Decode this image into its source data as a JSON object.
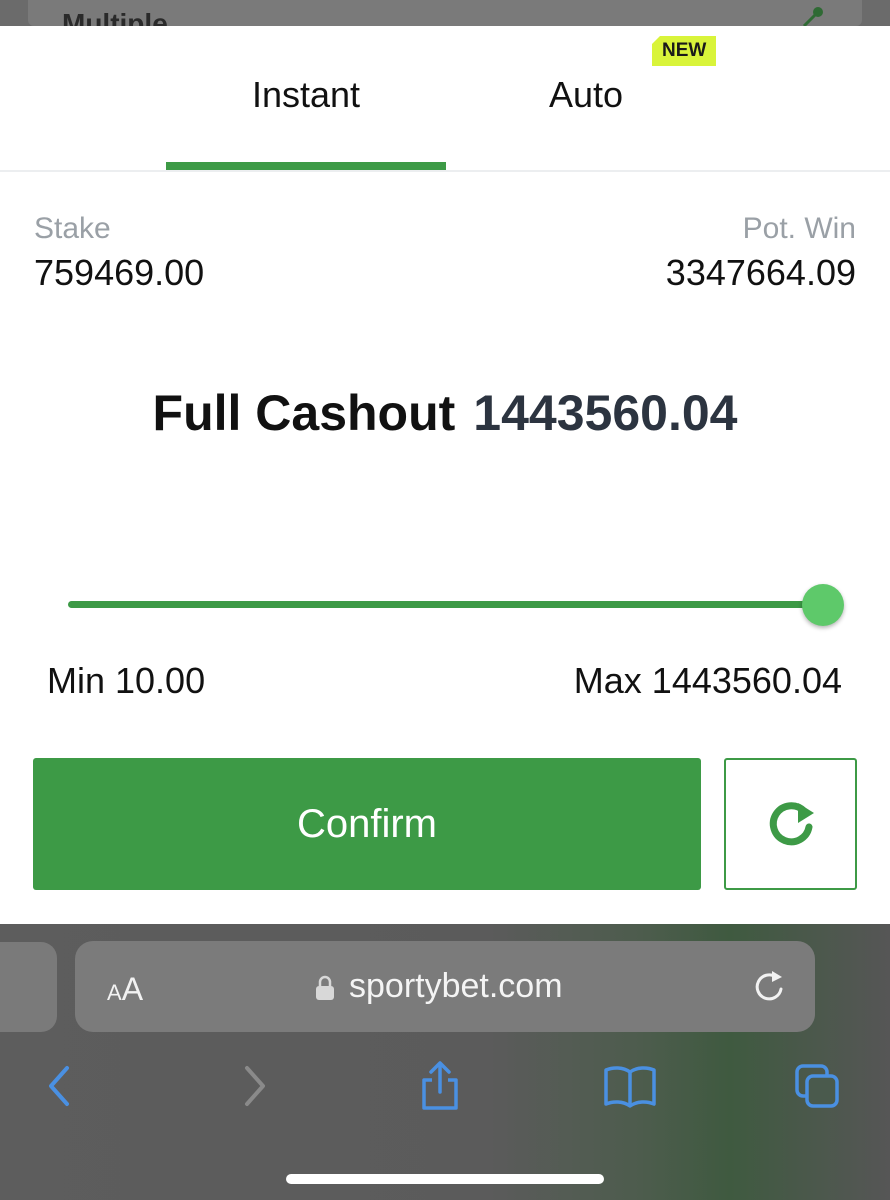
{
  "behind": {
    "title": "Multiple"
  },
  "tabs": [
    {
      "label": "Instant",
      "active": true
    },
    {
      "label": "Auto",
      "active": false,
      "badge": "NEW"
    }
  ],
  "stake": {
    "label": "Stake",
    "value": "759469.00"
  },
  "pot_win": {
    "label": "Pot. Win",
    "value": "3347664.09"
  },
  "cashout": {
    "label": "Full Cashout",
    "value": "1443560.04"
  },
  "slider": {
    "min_label": "Min 10.00",
    "max_label": "Max 1443560.04",
    "level": 1.0
  },
  "buttons": {
    "confirm": "Confirm",
    "refresh_icon": "refresh-icon"
  },
  "browser": {
    "text_size_label": "AA",
    "url": "sportybet.com",
    "icons": [
      "lock-icon",
      "reload-icon",
      "back-icon",
      "forward-icon",
      "share-icon",
      "bookmarks-icon",
      "tabs-icon"
    ]
  },
  "colors": {
    "accent": "#3d9a46",
    "badge": "#d9f43a",
    "thumb": "#5ec96a",
    "safari_blue": "#4a90e2"
  }
}
